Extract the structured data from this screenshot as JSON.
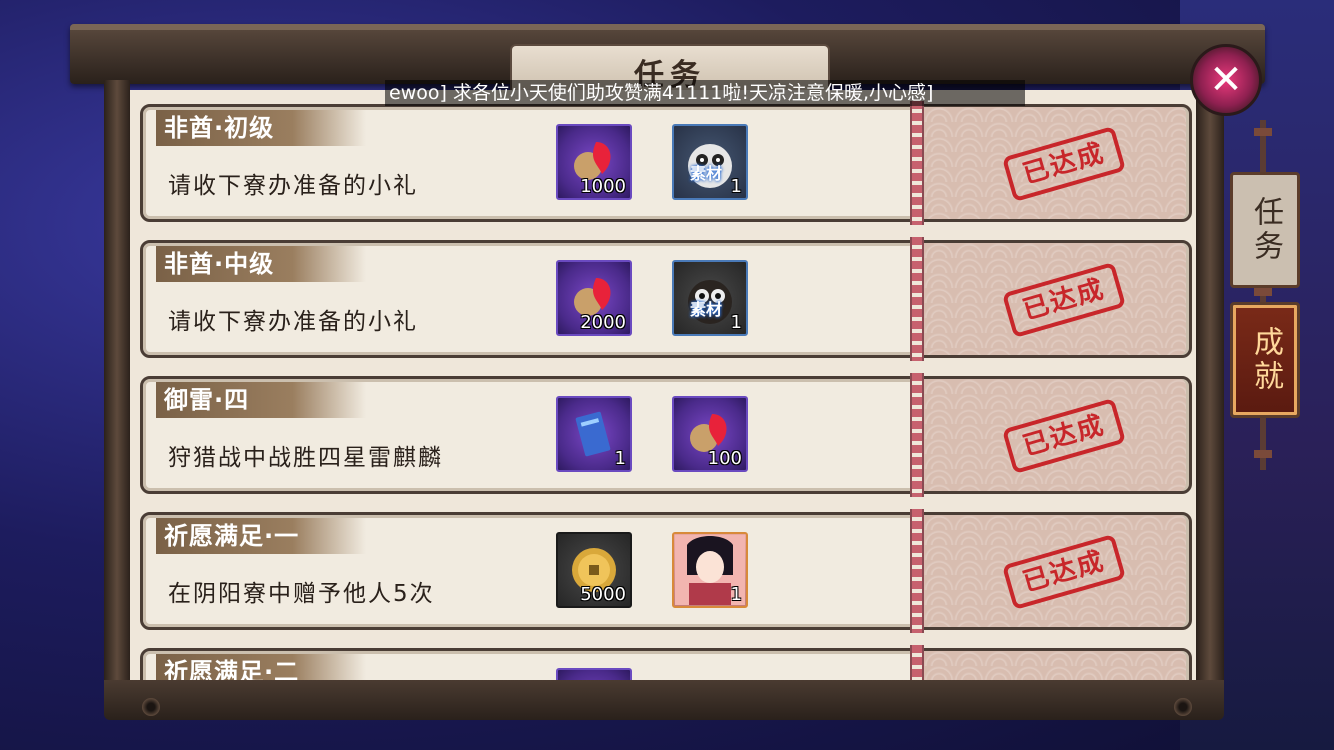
{
  "window": {
    "title": "任务"
  },
  "marquee": "ewoo] 求各位小天使们助攻赞满41111啦!天凉注意保暖,小心感]",
  "tabs": [
    {
      "label": "任务",
      "active": false
    },
    {
      "label": "成就",
      "active": true
    }
  ],
  "close_icon": "close-icon",
  "tasks": [
    {
      "name": "非酋·初级",
      "desc": "请收下寮办准备的小礼",
      "status": "已达成",
      "rewards": [
        {
          "icon": "magatama-icon",
          "qty": "1000",
          "tag": ""
        },
        {
          "icon": "daruma-white-icon",
          "qty": "1",
          "tag": "素材"
        }
      ]
    },
    {
      "name": "非酋·中级",
      "desc": "请收下寮办准备的小礼",
      "status": "已达成",
      "rewards": [
        {
          "icon": "magatama-icon",
          "qty": "2000",
          "tag": ""
        },
        {
          "icon": "daruma-black-icon",
          "qty": "1",
          "tag": "素材"
        }
      ]
    },
    {
      "name": "御雷·四",
      "desc": "狩猎战中战胜四星雷麒麟",
      "status": "已达成",
      "rewards": [
        {
          "icon": "ticket-icon",
          "qty": "1",
          "tag": ""
        },
        {
          "icon": "magatama-icon",
          "qty": "100",
          "tag": ""
        }
      ]
    },
    {
      "name": "祈愿满足·一",
      "desc": "在阴阳寮中赠予他人5次",
      "status": "已达成",
      "rewards": [
        {
          "icon": "gold-coin-icon",
          "qty": "5000",
          "tag": ""
        },
        {
          "icon": "shikigami-portrait-icon",
          "qty": "1",
          "tag": ""
        }
      ]
    },
    {
      "name": "祈愿满足·二",
      "desc": "",
      "status": "",
      "rewards": []
    }
  ],
  "colors": {
    "stamp": "#c8262a",
    "frame": "#4a3d35",
    "paper": "#efe7da"
  }
}
